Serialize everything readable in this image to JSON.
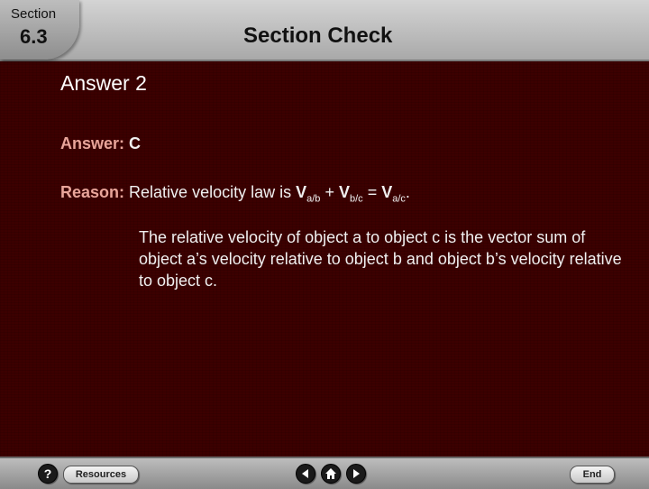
{
  "header": {
    "section_label": "Section",
    "section_number": "6.3",
    "title": "Section Check"
  },
  "content": {
    "answer_heading": "Answer 2",
    "answer_label": "Answer:",
    "answer_value": "C",
    "reason_label": "Reason:",
    "reason_text": "Relative velocity law is",
    "v1": "V",
    "v1_sub": "a/b",
    "plus": "+",
    "v2": "V",
    "v2_sub": "b/c",
    "equals": "=",
    "v3": "V",
    "v3_sub": "a/c",
    "period": ".",
    "explanation": "The relative velocity of object a to object c is the vector sum of object a’s velocity relative to object b and object b’s velocity relative to object c."
  },
  "footer": {
    "help_icon": "question-icon",
    "resources_label": "Resources",
    "prev_icon": "left-arrow-icon",
    "home_icon": "home-icon",
    "next_icon": "right-arrow-icon",
    "end_label": "End"
  },
  "colors": {
    "background": "#3c0000",
    "label_accent": "#e8a59a",
    "text": "#f0f0f0"
  }
}
